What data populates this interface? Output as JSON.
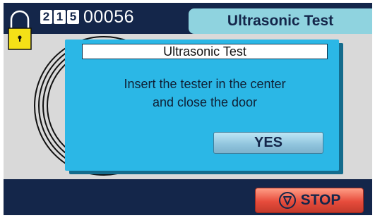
{
  "header": {
    "counter_digits": [
      "2",
      "1",
      "5"
    ],
    "counter_value": "00056",
    "title": "Ultrasonic Test"
  },
  "dialog": {
    "title": "Ultrasonic Test",
    "message_line1": "Insert the tester in the center",
    "message_line2": "and close the door",
    "yes_label": "YES"
  },
  "footer": {
    "stop_label": "STOP",
    "stop_icon": "stop-octagon-icon"
  },
  "icons": {
    "lock": "padlock-icon",
    "chamber": "ultrasonic-chamber-icon"
  },
  "colors": {
    "frame": "#14264a",
    "header_tab": "#8fd3df",
    "dialog": "#2bb7e6",
    "stop": "#e74c3c",
    "lock": "#f4e017"
  }
}
